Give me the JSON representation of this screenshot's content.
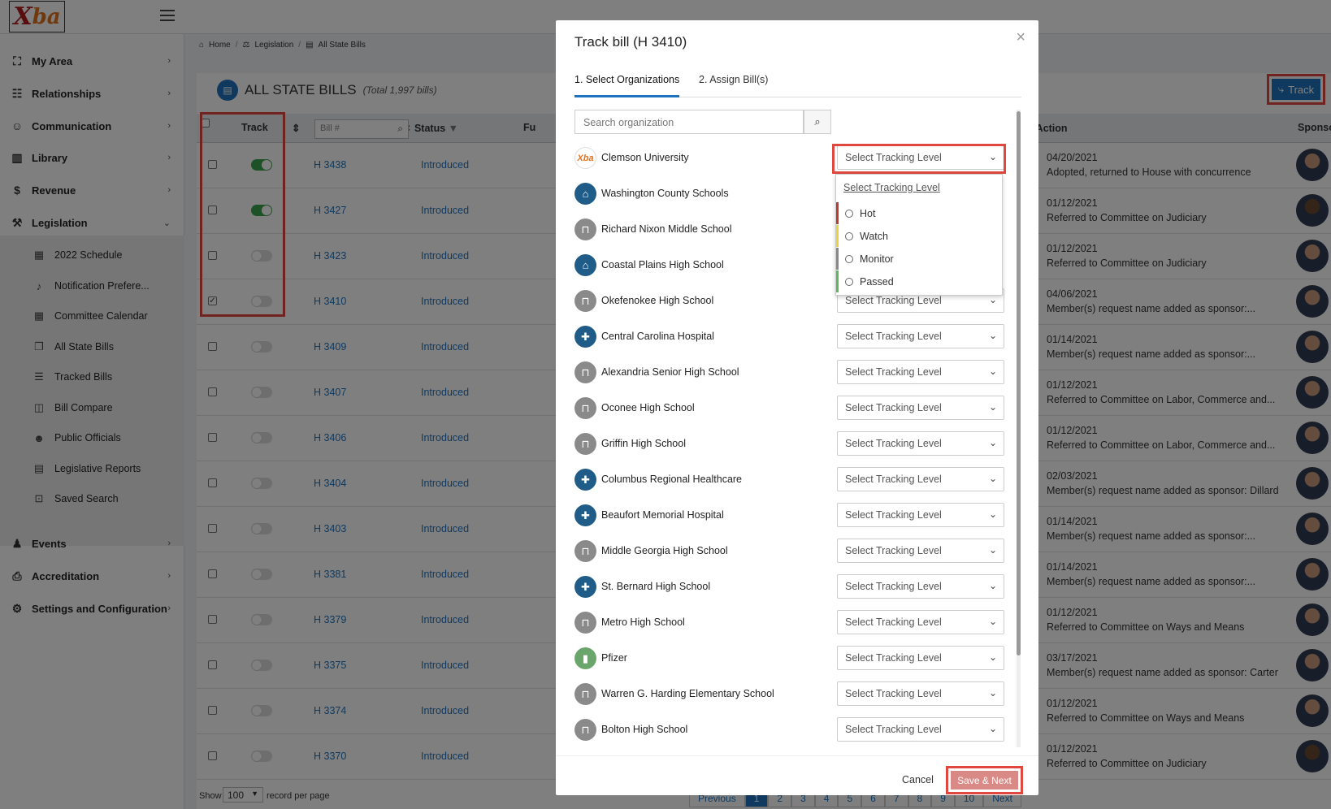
{
  "app": {
    "logo_text": "Xba"
  },
  "sidebar": {
    "items": [
      {
        "label": "My Area",
        "icon": "grid-icon"
      },
      {
        "label": "Relationships",
        "icon": "network-icon"
      },
      {
        "label": "Communication",
        "icon": "people-icon"
      },
      {
        "label": "Library",
        "icon": "book-icon"
      },
      {
        "label": "Revenue",
        "icon": "dollar-icon"
      },
      {
        "label": "Legislation",
        "icon": "gavel-icon"
      },
      {
        "label": "Events",
        "icon": "person-icon"
      },
      {
        "label": "Accreditation",
        "icon": "certificate-icon"
      },
      {
        "label": "Settings and Configuration",
        "icon": "gears-icon"
      }
    ],
    "legislation_sub": [
      {
        "label": "2022 Schedule",
        "icon": "calendar-icon"
      },
      {
        "label": "Notification Prefere...",
        "icon": "bell-icon"
      },
      {
        "label": "Committee Calendar",
        "icon": "calendar-icon"
      },
      {
        "label": "All State Bills",
        "icon": "documents-icon"
      },
      {
        "label": "Tracked Bills",
        "icon": "list-icon"
      },
      {
        "label": "Bill Compare",
        "icon": "compare-icon"
      },
      {
        "label": "Public Officials",
        "icon": "group-icon"
      },
      {
        "label": "Legislative Reports",
        "icon": "report-icon"
      },
      {
        "label": "Saved Search",
        "icon": "save-search-icon"
      }
    ]
  },
  "breadcrumb": {
    "home": "Home",
    "legislation": "Legislation",
    "current": "All State Bills"
  },
  "page": {
    "title": "ALL STATE BILLS",
    "subtitle": "(Total 1,997 bills)",
    "track_button": "Track"
  },
  "table": {
    "headers": {
      "track": "Track",
      "bill_placeholder": "Bill #",
      "status": "Status",
      "fu": "Fu",
      "last_action": "Last Action",
      "sponsor": "Sponso"
    },
    "rows": [
      {
        "bill": "H 3438",
        "status": "Introduced",
        "date": "04/20/2021",
        "action": "Adopted, returned to House with concurrence",
        "tracked": true,
        "checked": false
      },
      {
        "bill": "H 3427",
        "status": "Introduced",
        "date": "01/12/2021",
        "action": "Referred to Committee on Judiciary",
        "tracked": true,
        "checked": false
      },
      {
        "bill": "H 3423",
        "status": "Introduced",
        "date": "01/12/2021",
        "action": "Referred to Committee on Judiciary",
        "tracked": false,
        "checked": false
      },
      {
        "bill": "H 3410",
        "status": "Introduced",
        "date": "04/06/2021",
        "action": "Member(s) request name added as sponsor:...",
        "tracked": false,
        "checked": true
      },
      {
        "bill": "H 3409",
        "status": "Introduced",
        "date": "01/14/2021",
        "action": "Member(s) request name added as sponsor:...",
        "tracked": false,
        "checked": false
      },
      {
        "bill": "H 3407",
        "status": "Introduced",
        "date": "01/12/2021",
        "action": "Referred to Committee on Labor, Commerce and...",
        "tracked": false,
        "checked": false
      },
      {
        "bill": "H 3406",
        "status": "Introduced",
        "date": "01/12/2021",
        "action": "Referred to Committee on Labor, Commerce and...",
        "tracked": false,
        "checked": false
      },
      {
        "bill": "H 3404",
        "status": "Introduced",
        "date": "02/03/2021",
        "action": "Member(s) request name added as sponsor: Dillard",
        "tracked": false,
        "checked": false
      },
      {
        "bill": "H 3403",
        "status": "Introduced",
        "date": "01/14/2021",
        "action": "Member(s) request name added as sponsor:...",
        "tracked": false,
        "checked": false
      },
      {
        "bill": "H 3381",
        "status": "Introduced",
        "date": "01/14/2021",
        "action": "Member(s) request name added as sponsor:...",
        "tracked": false,
        "checked": false
      },
      {
        "bill": "H 3379",
        "status": "Introduced",
        "date": "01/12/2021",
        "action": "Referred to Committee on Ways and Means",
        "tracked": false,
        "checked": false
      },
      {
        "bill": "H 3375",
        "status": "Introduced",
        "date": "03/17/2021",
        "action": "Member(s) request name added as sponsor: Carter",
        "tracked": false,
        "checked": false
      },
      {
        "bill": "H 3374",
        "status": "Introduced",
        "date": "01/12/2021",
        "action": "Referred to Committee on Ways and Means",
        "tracked": false,
        "checked": false
      },
      {
        "bill": "H 3370",
        "status": "Introduced",
        "date": "01/12/2021",
        "action": "Referred to Committee on Judiciary",
        "tracked": false,
        "checked": false
      }
    ]
  },
  "footer": {
    "show": "Show",
    "per_page": "100",
    "record_label": "record per page",
    "pager": [
      "Previous",
      "1",
      "2",
      "3",
      "4",
      "5",
      "6",
      "7",
      "8",
      "9",
      "10",
      "Next"
    ],
    "active_page": "1"
  },
  "modal": {
    "title": "Track bill (H 3410)",
    "close": "×",
    "tabs": [
      "1. Select Organizations",
      "2. Assign Bill(s)"
    ],
    "search_placeholder": "Search organization",
    "select_placeholder": "Select Tracking Level",
    "dropdown": {
      "header": "Select Tracking Level",
      "options": [
        {
          "label": "Hot",
          "color": "#c0392b"
        },
        {
          "label": "Watch",
          "color": "#e8d43a"
        },
        {
          "label": "Monitor",
          "color": "#888888"
        },
        {
          "label": "Passed",
          "color": "#5cb85c"
        }
      ]
    },
    "organizations": [
      {
        "name": "Clemson University",
        "icon": "clemson-logo-icon"
      },
      {
        "name": "Washington County Schools",
        "icon": "school-icon"
      },
      {
        "name": "Richard Nixon Middle School",
        "icon": "building-icon"
      },
      {
        "name": "Coastal Plains High School",
        "icon": "school-icon"
      },
      {
        "name": "Okefenokee High School",
        "icon": "building-icon"
      },
      {
        "name": "Central Carolina Hospital",
        "icon": "hospital-icon"
      },
      {
        "name": "Alexandria Senior High School",
        "icon": "building-icon"
      },
      {
        "name": "Oconee High School",
        "icon": "building-icon"
      },
      {
        "name": "Griffin High School",
        "icon": "building-icon"
      },
      {
        "name": "Columbus Regional Healthcare",
        "icon": "hospital-icon"
      },
      {
        "name": "Beaufort Memorial Hospital",
        "icon": "hospital-icon"
      },
      {
        "name": "Middle Georgia High School",
        "icon": "building-icon"
      },
      {
        "name": "St. Bernard High School",
        "icon": "hospital-icon"
      },
      {
        "name": "Metro High School",
        "icon": "building-icon"
      },
      {
        "name": "Pfizer",
        "icon": "pharma-icon"
      },
      {
        "name": "Warren G. Harding Elementary School",
        "icon": "building-icon"
      },
      {
        "name": "Bolton High School",
        "icon": "building-icon"
      }
    ],
    "cancel": "Cancel",
    "save": "Save & Next"
  }
}
